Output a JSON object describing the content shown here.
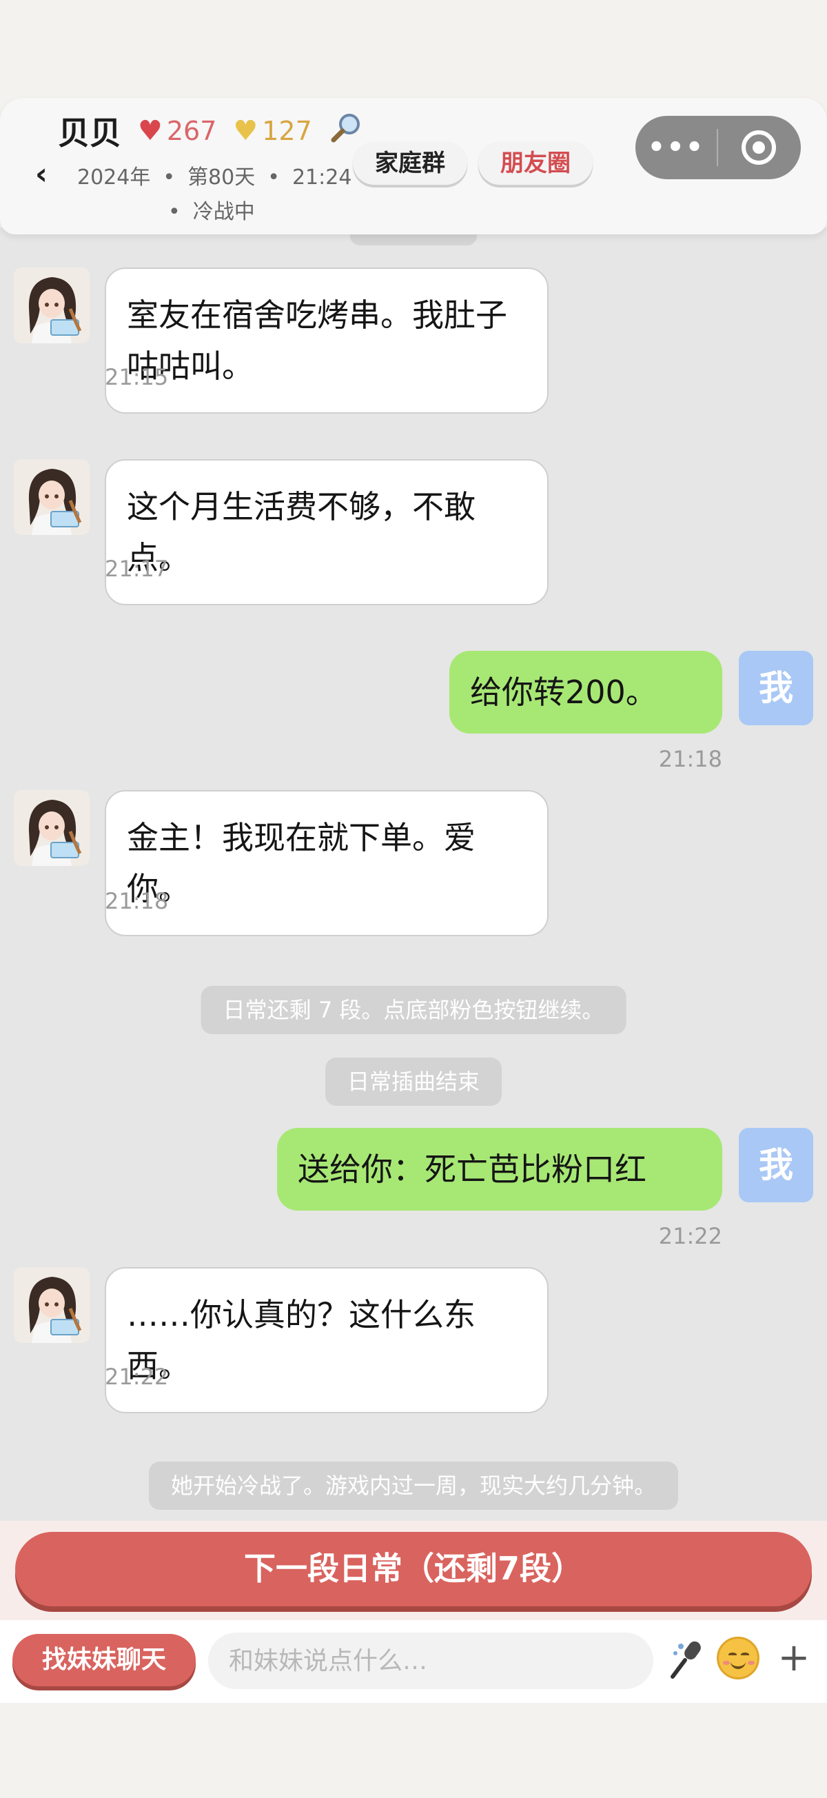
{
  "header": {
    "back_icon": "chevron-left-icon",
    "name": "贝贝",
    "affection_icon": "heart-red-icon",
    "affection_value": "267",
    "favor_icon": "heart-gold-icon",
    "favor_value": "127",
    "search_icon": "magnifier-icon",
    "year": "2024年",
    "day": "第80天",
    "time": "21:24",
    "status": "冷战中",
    "family_group_label": "家庭群",
    "moments_label": "朋友圈",
    "capsule_more_icon": "more-dots-icon",
    "capsule_close_icon": "target-circle-icon"
  },
  "messages": [
    {
      "side": "left",
      "text": "室友在宿舍吃烤串。我肚子咕咕叫。",
      "time": "21:15"
    },
    {
      "side": "left",
      "text": "这个月生活费不够，不敢点。",
      "time": "21:17"
    },
    {
      "side": "right",
      "text": "给你转200。",
      "time": "21:18",
      "avatar_label": "我"
    },
    {
      "side": "left",
      "text": "金主！我现在就下单。爱你。",
      "time": "21:18"
    },
    {
      "side": "right",
      "text": "送给你：死亡芭比粉口红",
      "time": "21:22",
      "avatar_label": "我"
    },
    {
      "side": "left",
      "text": "……你认真的？这什么东西。",
      "time": "21:22"
    }
  ],
  "system": {
    "remaining_tip": "日常还剩 7 段。点底部粉色按钮继续。",
    "episode_end": "日常插曲结束",
    "cold_war_tip": "她开始冷战了。游戏内过一周，现实大约几分钟。"
  },
  "bottom": {
    "next_button": "下一段日常（还剩7段）",
    "find_sister_button": "找妹妹聊天",
    "input_placeholder": "和妹妹说点什么…",
    "mic_icon": "microphone-icon",
    "emoji_icon": "smile-emoji-icon",
    "plus_icon": "plus-icon"
  },
  "colors": {
    "accent_red": "#d9635e",
    "bubble_green": "#a7e875",
    "me_avatar_blue": "#a9c8f6"
  }
}
